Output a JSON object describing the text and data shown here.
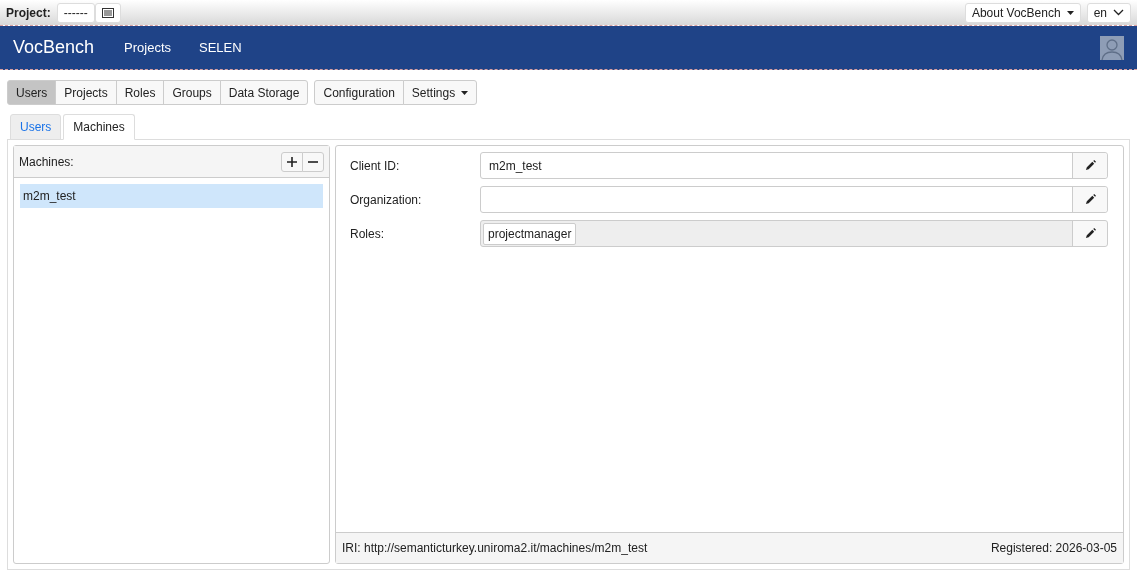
{
  "topbar": {
    "project_label": "Project:",
    "project_value": "------",
    "about": "About VocBench",
    "language": "en"
  },
  "navbar": {
    "brand": "VocBench",
    "links": [
      "Projects",
      "SELEN"
    ]
  },
  "admin_tabs": [
    {
      "buttons": [
        {
          "label": "Users",
          "selected": true,
          "kind": "plain"
        },
        {
          "label": "Projects",
          "selected": false,
          "kind": "plain"
        },
        {
          "label": "Roles",
          "selected": false,
          "kind": "plain"
        },
        {
          "label": "Groups",
          "selected": false,
          "kind": "plain"
        },
        {
          "label": "Data Storage",
          "selected": false,
          "kind": "plain"
        }
      ]
    },
    {
      "buttons": [
        {
          "label": "Configuration",
          "selected": false,
          "kind": "plain"
        },
        {
          "label": "Settings",
          "selected": false,
          "kind": "dropdown"
        }
      ]
    }
  ],
  "sub_tabs": [
    {
      "label": "Users",
      "selected": false
    },
    {
      "label": "Machines",
      "selected": true
    }
  ],
  "machines": {
    "title": "Machines:",
    "items": [
      {
        "label": "m2m_test",
        "selected": true
      }
    ]
  },
  "details": {
    "fields": [
      {
        "label": "Client ID:",
        "kind": "text",
        "value": "m2m_test"
      },
      {
        "label": "Organization:",
        "kind": "text"
      },
      {
        "label": "Roles:",
        "kind": "tags",
        "tags": [
          "projectmanager"
        ]
      }
    ],
    "iri": "IRI: http://semanticturkey.uniroma2.it/machines/m2m_test",
    "registered": "Registered: 2026-03-05"
  }
}
